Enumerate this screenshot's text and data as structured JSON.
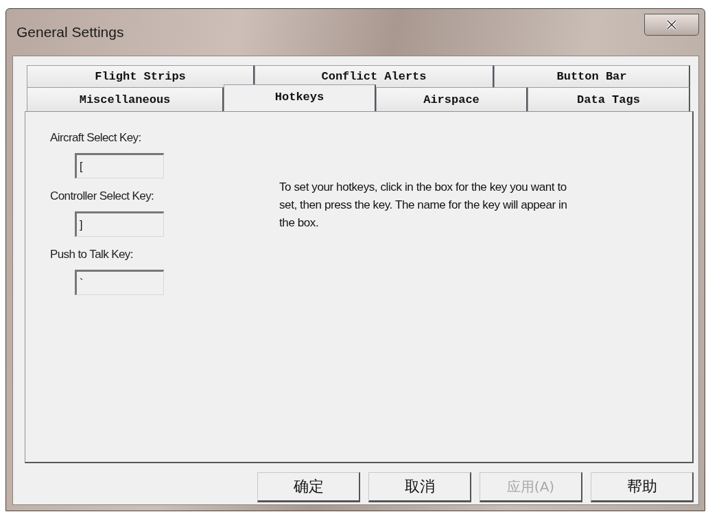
{
  "window": {
    "title": "General Settings"
  },
  "tab_rows": [
    [
      {
        "label": "Flight Strips",
        "selected": false
      },
      {
        "label": "Conflict Alerts",
        "selected": false
      },
      {
        "label": "Button Bar",
        "selected": false
      }
    ],
    [
      {
        "label": "Miscellaneous",
        "selected": false
      },
      {
        "label": "Hotkeys",
        "selected": true
      },
      {
        "label": "Airspace",
        "selected": false
      },
      {
        "label": "Data Tags",
        "selected": false
      }
    ]
  ],
  "fields": [
    {
      "label": "Aircraft Select Key:",
      "value": "["
    },
    {
      "label": "Controller Select Key:",
      "value": "]"
    },
    {
      "label": "Push to Talk Key:",
      "value": "`"
    }
  ],
  "instructions": "To set your hotkeys, click in the box for the key you want to set, then press the key. The name for the key will appear in the box.",
  "buttons": [
    {
      "label": "确定",
      "disabled": false
    },
    {
      "label": "取消",
      "disabled": false
    },
    {
      "label": "应用(A)",
      "disabled": true
    },
    {
      "label": "帮助",
      "disabled": false
    }
  ]
}
